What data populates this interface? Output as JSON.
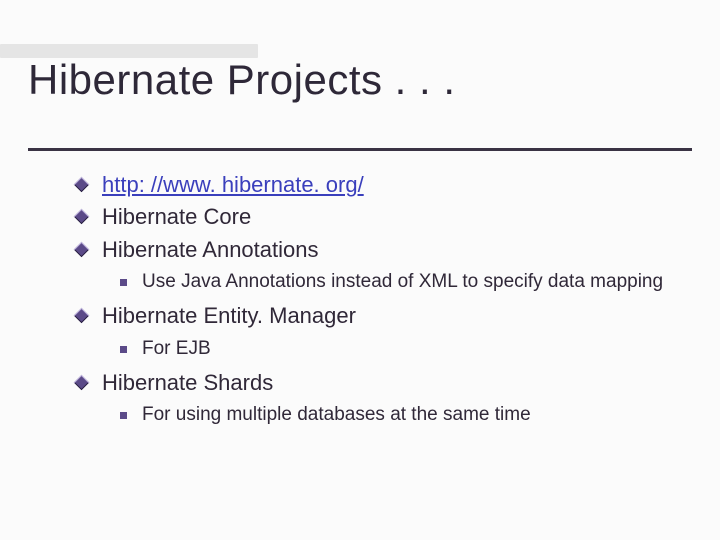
{
  "title": "Hibernate Projects . . .",
  "items": {
    "link": "http: //www. hibernate. org/",
    "core": "Hibernate Core",
    "annotations": "Hibernate Annotations",
    "annotations_sub": "Use Java Annotations instead of XML to specify data mapping",
    "entitymanager": "Hibernate Entity. Manager",
    "entitymanager_sub": "For EJB",
    "shards": "Hibernate Shards",
    "shards_sub": "For using multiple databases at the same time"
  }
}
